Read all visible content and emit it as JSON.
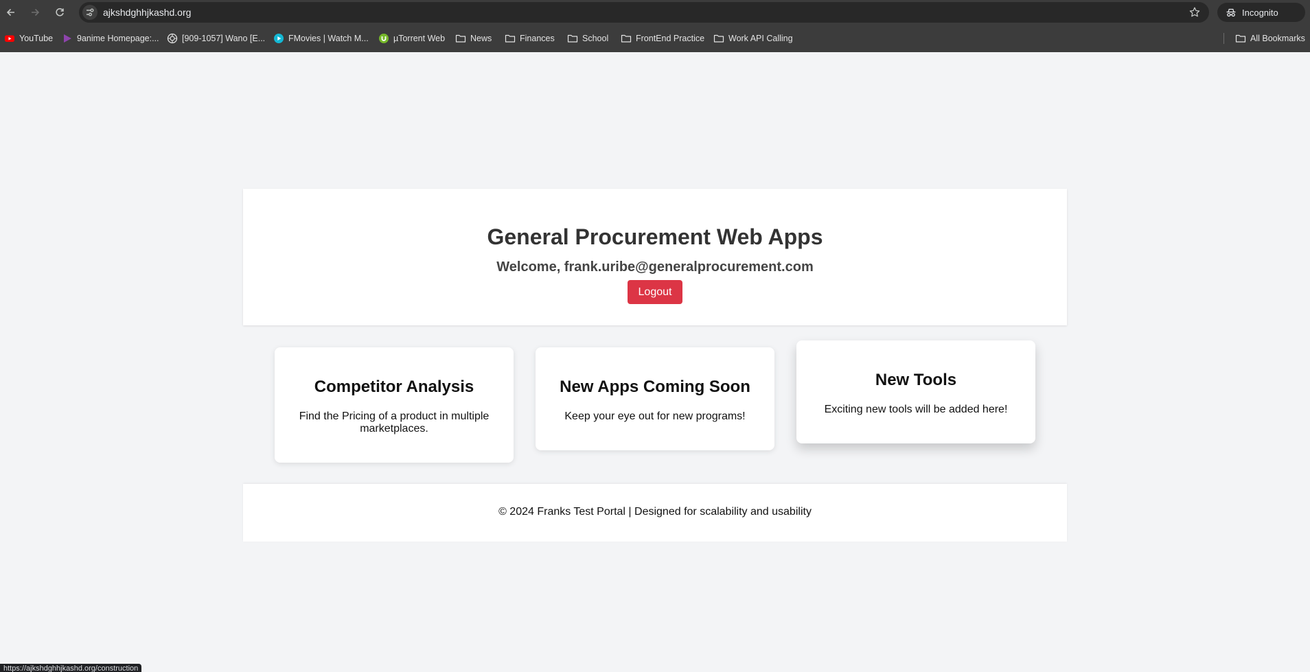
{
  "browser": {
    "url": "ajkshdghhjkashd.org",
    "incognito_label": "Incognito",
    "status_url": "https://ajkshdghhjkashd.org/construction",
    "bookmarks": [
      {
        "label": "YouTube",
        "icon": "youtube-icon"
      },
      {
        "label": "9anime Homepage:...",
        "icon": "play-triangle-icon"
      },
      {
        "label": "[909-1057] Wano [E...",
        "icon": "globe-icon"
      },
      {
        "label": "FMovies | Watch M...",
        "icon": "play-circle-icon"
      },
      {
        "label": "µTorrent Web",
        "icon": "utorrent-icon"
      },
      {
        "label": "News",
        "icon": "folder-icon"
      },
      {
        "label": "Finances",
        "icon": "folder-icon"
      },
      {
        "label": "School",
        "icon": "folder-icon"
      },
      {
        "label": "FrontEnd Practice",
        "icon": "folder-icon"
      },
      {
        "label": "Work API Calling",
        "icon": "folder-icon"
      }
    ],
    "all_bookmarks_label": "All Bookmarks"
  },
  "header": {
    "title": "General Procurement Web Apps",
    "welcome": "Welcome, frank.uribe@generalprocurement.com",
    "logout_label": "Logout"
  },
  "cards": [
    {
      "title": "Competitor Analysis",
      "text": "Find the Pricing of a product in multiple marketplaces."
    },
    {
      "title": "New Apps Coming Soon",
      "text": "Keep your eye out for new programs!"
    },
    {
      "title": "New Tools",
      "text": "Exciting new tools will be added here!"
    }
  ],
  "footer": {
    "text": "© 2024 Franks Test Portal | Designed for scalability and usability"
  },
  "colors": {
    "logout": "#dc3545",
    "page_background": "#f3f4f6",
    "chrome_background": "#3c3c3c"
  }
}
